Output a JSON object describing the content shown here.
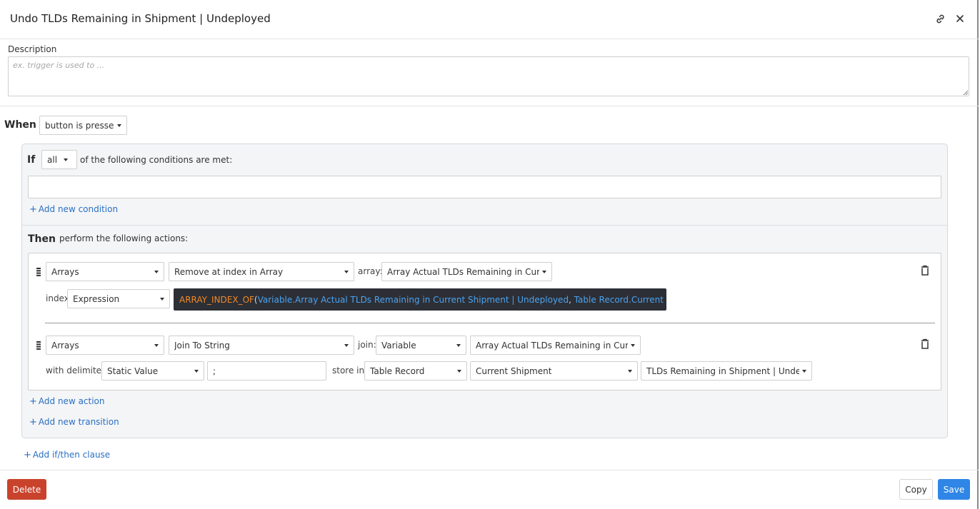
{
  "dialog": {
    "title": "Undo TLDs Remaining in Shipment | Undeployed",
    "link_icon": "link-icon",
    "close_icon": "close-icon"
  },
  "description": {
    "label": "Description",
    "placeholder": "ex. trigger is used to ...",
    "value": ""
  },
  "when": {
    "keyword": "When",
    "trigger": "button is pressed"
  },
  "clause": {
    "if_keyword": "If",
    "match_mode": "all",
    "conditions_text": "of the following conditions are met:",
    "add_condition": "Add new condition",
    "then_keyword": "Then",
    "actions_text": "perform the following actions:",
    "actions": [
      {
        "category": "Arrays",
        "operation": "Remove at index in Array",
        "array_label": "array:",
        "array_value": "Array Actual TLDs Remaining in Current",
        "index_label": "index",
        "index_type": "Expression",
        "expression": {
          "fn": "ARRAY_INDEX_OF",
          "open": "(",
          "arg1": "Variable.Array Actual TLDs Remaining in Current Shipment | Undeployed",
          "comma": ", ",
          "arg2": "Table Record.Current Picked TLD.ID",
          "close": ")"
        }
      },
      {
        "category": "Arrays",
        "operation": "Join To String",
        "join_label": "join:",
        "join_type": "Variable",
        "join_value": "Array Actual TLDs Remaining in Current",
        "delimiter_label": "with delimiter:",
        "delimiter_type": "Static Value",
        "delimiter_value": ";",
        "store_label": "store in:",
        "store_type": "Table Record",
        "store_record": "Current Shipment",
        "store_field": "TLDs Remaining in Shipment | Undeplo"
      }
    ],
    "add_action": "Add new action",
    "add_transition": "Add new transition"
  },
  "add_clause": "Add if/then clause",
  "footer": {
    "delete_label": "Delete",
    "copy_label": "Copy",
    "save_label": "Save"
  },
  "colors": {
    "link": "#2a6fc2",
    "delete": "#c9432c",
    "save": "#2f86e6",
    "expression_bg": "#2d2f36",
    "expression_fn": "#f08a24",
    "expression_var": "#4aa3f0"
  }
}
